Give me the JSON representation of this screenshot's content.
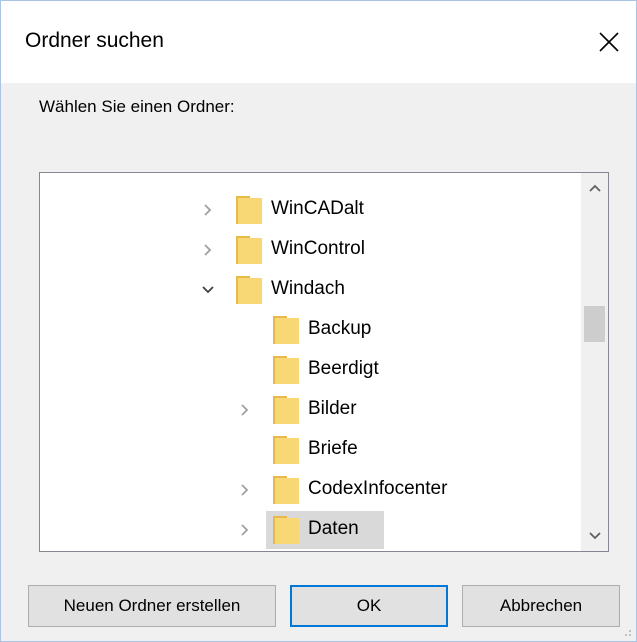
{
  "dialog": {
    "title": "Ordner suchen",
    "prompt": "Wählen Sie einen Ordner:"
  },
  "tree": {
    "items": [
      {
        "label": "WinCADalt",
        "expander": "collapsed",
        "level": 0,
        "icon": "folder-icon"
      },
      {
        "label": "WinControl",
        "expander": "collapsed",
        "level": 0,
        "icon": "folder-icon"
      },
      {
        "label": "Windach",
        "expander": "expanded",
        "level": 0,
        "icon": "folder-icon"
      },
      {
        "label": "Backup",
        "expander": "none",
        "level": 1,
        "icon": "folder-icon"
      },
      {
        "label": "Beerdigt",
        "expander": "none",
        "level": 1,
        "icon": "folder-icon"
      },
      {
        "label": "Bilder",
        "expander": "collapsed",
        "level": 1,
        "icon": "folder-icon"
      },
      {
        "label": "Briefe",
        "expander": "none",
        "level": 1,
        "icon": "folder-icon"
      },
      {
        "label": "CodexInfocenter",
        "expander": "collapsed",
        "level": 1,
        "icon": "folder-icon"
      },
      {
        "label": "Daten",
        "expander": "collapsed",
        "level": 1,
        "icon": "folder-icon",
        "selected": true
      }
    ]
  },
  "buttons": {
    "new_folder": "Neuen Ordner erstellen",
    "ok": "OK",
    "cancel": "Abbrechen"
  },
  "colors": {
    "folder_fill": "#f8d775",
    "folder_shade": "#e8b84a",
    "accent": "#0078d7",
    "selection": "#d9d9d9"
  }
}
